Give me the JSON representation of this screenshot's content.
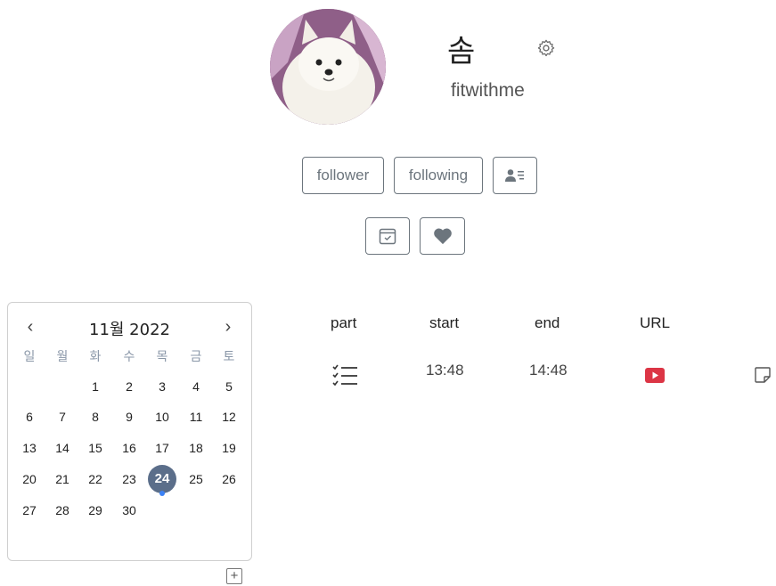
{
  "profile": {
    "name": "솜",
    "handle": "fitwithme",
    "avatar_icon": "pomeranian-dog-photo"
  },
  "buttons": {
    "follower": "follower",
    "following": "following"
  },
  "calendar": {
    "title": "11월 2022",
    "prev": "‹",
    "next": "›",
    "weekdays": [
      "일",
      "월",
      "화",
      "수",
      "목",
      "금",
      "토"
    ],
    "weeks": [
      [
        "",
        "",
        "1",
        "2",
        "3",
        "4",
        "5"
      ],
      [
        "6",
        "7",
        "8",
        "9",
        "10",
        "11",
        "12"
      ],
      [
        "13",
        "14",
        "15",
        "16",
        "17",
        "18",
        "19"
      ],
      [
        "20",
        "21",
        "22",
        "23",
        "24",
        "25",
        "26"
      ],
      [
        "27",
        "28",
        "29",
        "30",
        "",
        "",
        ""
      ]
    ],
    "selected": "24",
    "selected_color": "#5b6e8a"
  },
  "table": {
    "headers": [
      "part",
      "start",
      "end",
      "URL"
    ],
    "row": {
      "start": "13:48",
      "end": "14:48",
      "url_icon": "youtube-icon",
      "url_color": "#dc3545"
    }
  },
  "add_label": "+"
}
